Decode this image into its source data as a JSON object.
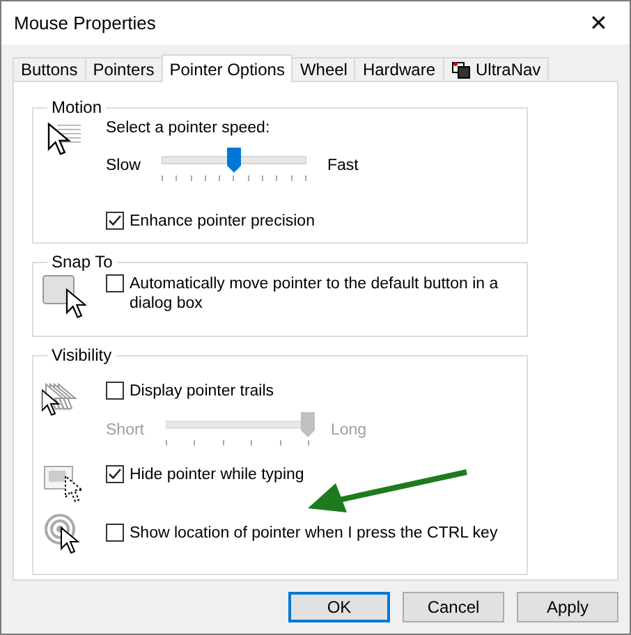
{
  "window": {
    "title": "Mouse Properties",
    "close": "✕"
  },
  "tabs": [
    {
      "label": "Buttons",
      "selected": false
    },
    {
      "label": "Pointers",
      "selected": false
    },
    {
      "label": "Pointer Options",
      "selected": true
    },
    {
      "label": "Wheel",
      "selected": false
    },
    {
      "label": "Hardware",
      "selected": false
    },
    {
      "label": "UltraNav",
      "selected": false,
      "kind": "icon"
    }
  ],
  "motion": {
    "title": "Motion",
    "speed_label": "Select a pointer speed:",
    "slider": {
      "min_label": "Slow",
      "max_label": "Fast",
      "level": 0.5,
      "disabled": false
    },
    "precision": {
      "label": "Enhance pointer precision",
      "checked": true
    }
  },
  "snap_to": {
    "title": "Snap To",
    "option": {
      "label": "Automatically move pointer to the default button in a dialog box",
      "checked": false
    }
  },
  "visibility": {
    "title": "Visibility",
    "trails": {
      "label": "Display pointer trails",
      "checked": false
    },
    "trail_slider": {
      "min_label": "Short",
      "max_label": "Long",
      "level": 1,
      "disabled": true
    },
    "hide": {
      "label": "Hide pointer while typing",
      "checked": true
    },
    "show_location": {
      "label": "Show location of pointer when I press the CTRL key",
      "checked": false
    }
  },
  "buttons": [
    {
      "label": "OK",
      "default": true
    },
    {
      "label": "Cancel",
      "default": false
    },
    {
      "label": "Apply",
      "default": false
    }
  ]
}
